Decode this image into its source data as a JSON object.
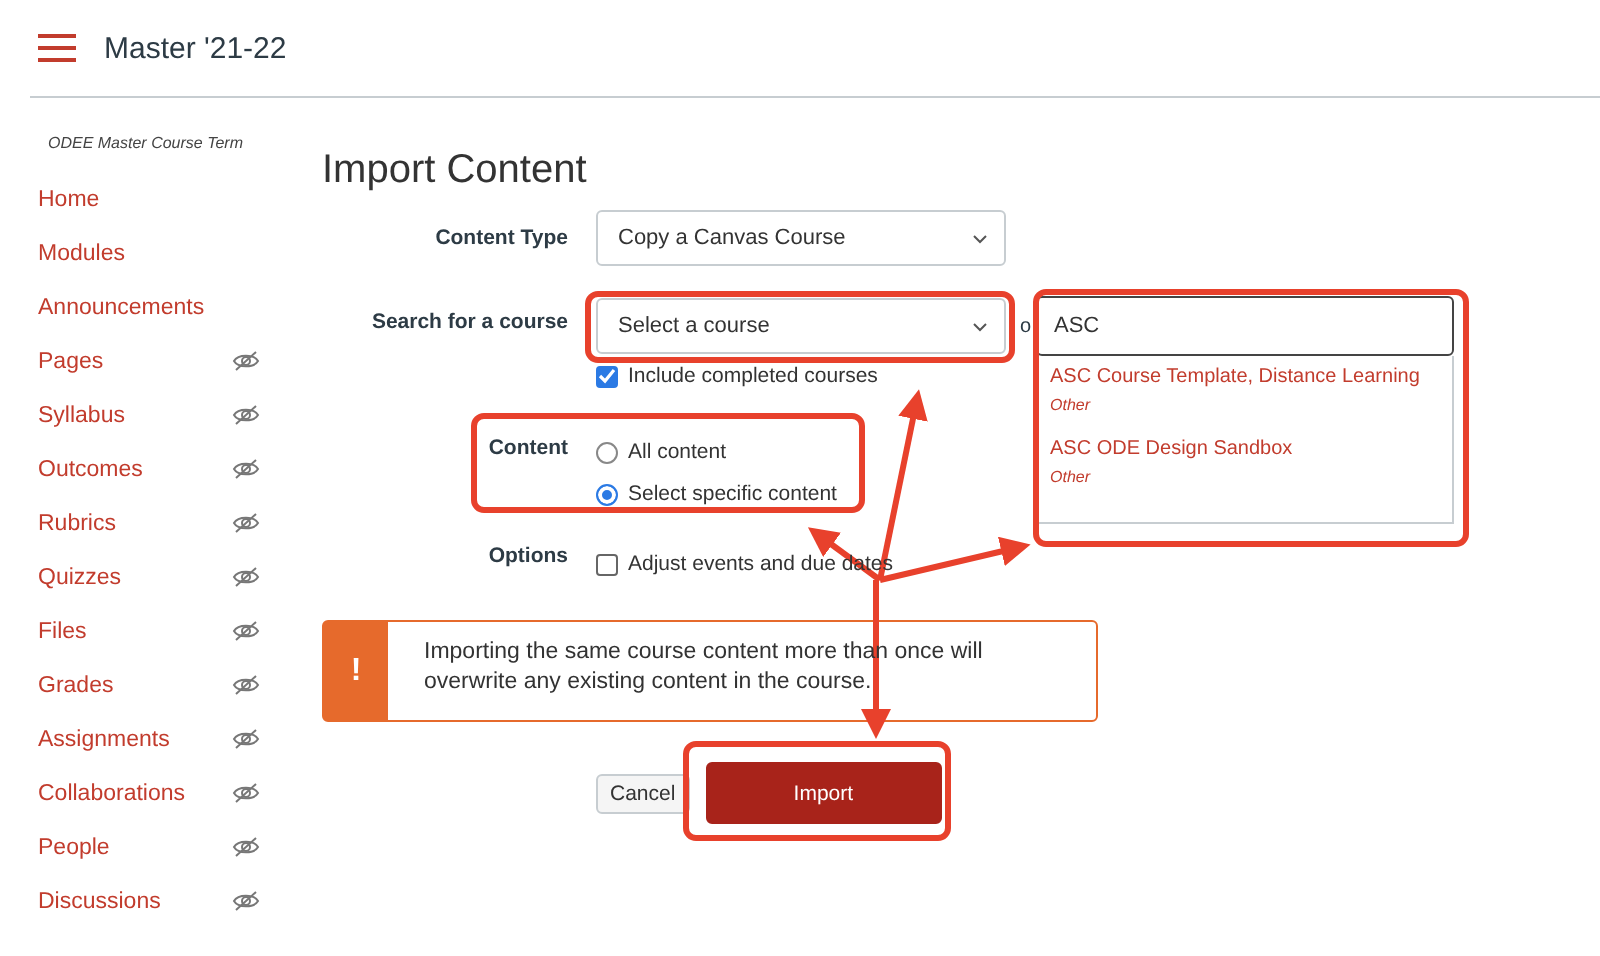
{
  "header": {
    "title": "Master '21-22"
  },
  "sidebar": {
    "term": "ODEE Master Course Term",
    "items": [
      {
        "label": "Home",
        "hidden": false
      },
      {
        "label": "Modules",
        "hidden": false
      },
      {
        "label": "Announcements",
        "hidden": false
      },
      {
        "label": "Pages",
        "hidden": true
      },
      {
        "label": "Syllabus",
        "hidden": true
      },
      {
        "label": "Outcomes",
        "hidden": true
      },
      {
        "label": "Rubrics",
        "hidden": true
      },
      {
        "label": "Quizzes",
        "hidden": true
      },
      {
        "label": "Files",
        "hidden": true
      },
      {
        "label": "Grades",
        "hidden": true
      },
      {
        "label": "Assignments",
        "hidden": true
      },
      {
        "label": "Collaborations",
        "hidden": true
      },
      {
        "label": "People",
        "hidden": true
      },
      {
        "label": "Discussions",
        "hidden": true
      }
    ]
  },
  "page": {
    "title": "Import Content"
  },
  "form": {
    "content_type": {
      "label": "Content Type",
      "value": "Copy a Canvas Course"
    },
    "course": {
      "label": "Search for a course",
      "placeholder": "Select a course",
      "or_text": "o",
      "search_value": "ASC",
      "include_completed": {
        "label": "Include completed courses",
        "checked": true
      },
      "results": [
        {
          "name": "ASC Course Template, Distance Learning",
          "term": "Other"
        },
        {
          "name": "ASC ODE Design Sandbox",
          "term": "Other"
        }
      ]
    },
    "content": {
      "label": "Content",
      "options": [
        {
          "label": "All content",
          "selected": false
        },
        {
          "label": "Select specific content",
          "selected": true
        }
      ]
    },
    "options": {
      "label": "Options",
      "items": [
        {
          "label": "Adjust events and due dates",
          "checked": false
        }
      ]
    }
  },
  "alert": {
    "icon": "!",
    "text": "Importing the same course content more than once will overwrite any existing content in the course."
  },
  "buttons": [
    {
      "label": "Cancel",
      "kind": "secondary"
    },
    {
      "label": "Import",
      "kind": "primary"
    }
  ]
}
